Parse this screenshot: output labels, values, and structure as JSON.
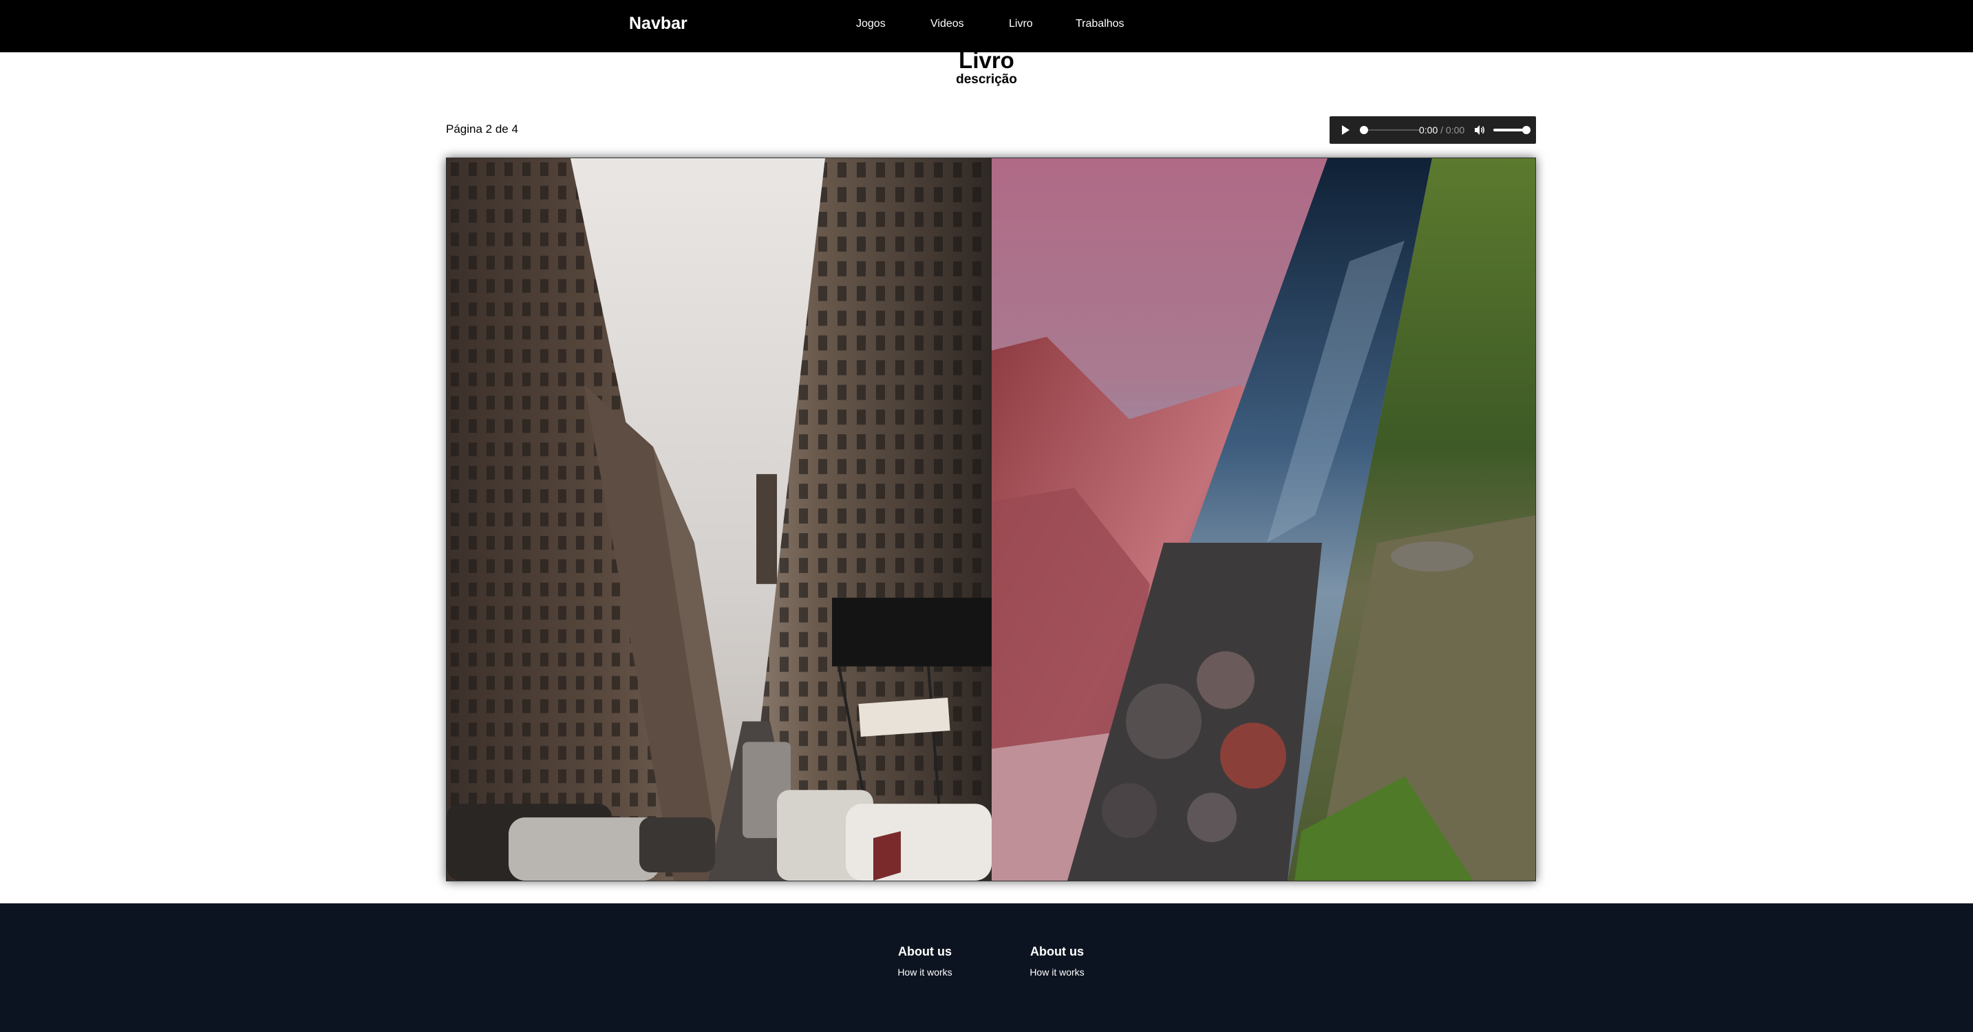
{
  "navbar": {
    "brand": "Navbar",
    "links": [
      {
        "label": "Jogos"
      },
      {
        "label": "Videos"
      },
      {
        "label": "Livro"
      },
      {
        "label": "Trabalhos"
      }
    ]
  },
  "header": {
    "title": "Livro",
    "subtitle": "descrição"
  },
  "book": {
    "page_indicator": "Página 2 de 4",
    "current_page": 2,
    "total_pages": 4,
    "left_page_image": "city-street-skyscrapers-photo",
    "right_page_image": "collage-red-rocks-sea-forest-river-photo"
  },
  "audio_player": {
    "current_time": "0:00",
    "separator": " / ",
    "duration": "0:00",
    "progress": 0,
    "volume": 1,
    "icons": {
      "play": "play-icon",
      "volume": "volume-icon"
    }
  },
  "footer": {
    "columns": [
      {
        "heading": "About us",
        "link": "How it works"
      },
      {
        "heading": "About us",
        "link": "How it works"
      }
    ]
  },
  "colors": {
    "navbar_bg": "#000000",
    "footer_bg": "#0d1421",
    "audio_bg": "#222222"
  }
}
